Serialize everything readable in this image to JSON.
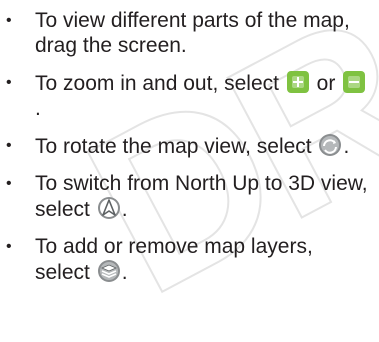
{
  "watermark": "DR",
  "items": [
    {
      "text": "To view different parts of the map, drag the screen."
    },
    {
      "before": "To zoom in and out, select",
      "mid": "or",
      "after": "."
    },
    {
      "before": "To rotate the map view, select",
      "after": "."
    },
    {
      "before": "To switch from North Up to 3D view, select",
      "after": "."
    },
    {
      "before": "To add or remove map layers, select",
      "after": "."
    }
  ],
  "icons": [
    "zoom-in-icon",
    "zoom-out-icon",
    "rotate-map-icon",
    "compass-3d-icon",
    "map-layers-icon"
  ],
  "colors": {
    "text": "#231f20",
    "icon_green": "#7fc241",
    "icon_gray": "#8a8d8f",
    "watermark": "#e4e4e4"
  }
}
